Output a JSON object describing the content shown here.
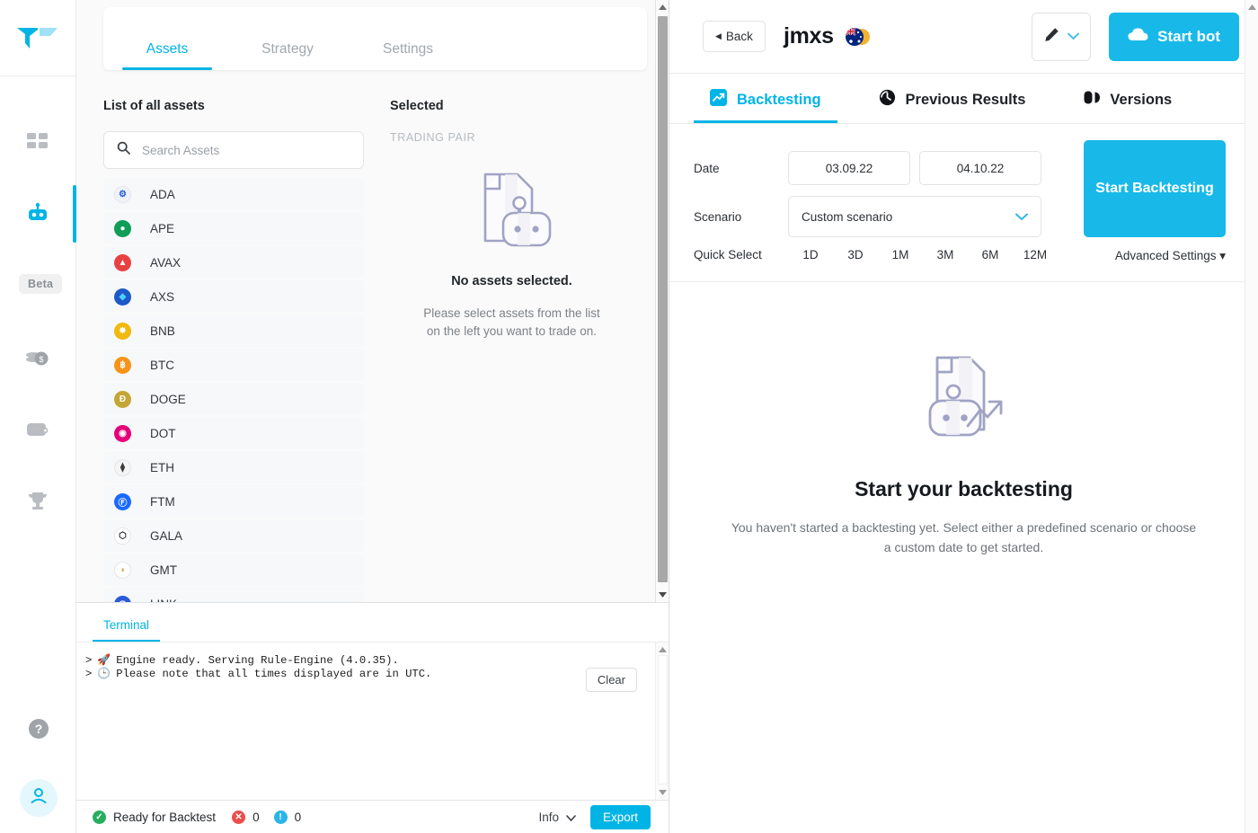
{
  "rail": {
    "logo": "trality-logo",
    "items": [
      {
        "name": "dashboard",
        "icon": "grid-icon"
      },
      {
        "name": "bots",
        "icon": "robot-icon",
        "active": true
      },
      {
        "name": "marketplace",
        "icon": "store-icon",
        "badge": "Beta"
      },
      {
        "name": "earnings",
        "icon": "coins-icon"
      },
      {
        "name": "wallet",
        "icon": "wallet-icon"
      },
      {
        "name": "leaderboard",
        "icon": "trophy-icon"
      }
    ],
    "help_icon": "help-circle-icon",
    "avatar_icon": "user-icon"
  },
  "editor": {
    "tabs": [
      {
        "label": "Assets",
        "active": true
      },
      {
        "label": "Strategy",
        "active": false
      },
      {
        "label": "Settings",
        "active": false
      }
    ],
    "assets_pane": {
      "title": "List of all assets",
      "search_placeholder": "Search Assets",
      "search_value": "",
      "search_icon": "search-icon",
      "assets": [
        {
          "symbol": "ADA",
          "color": "#eef3fb",
          "glyph": "⚙",
          "text_color": "#2a5ada"
        },
        {
          "symbol": "APE",
          "color": "#0f9d58",
          "glyph": "●",
          "text_color": "#ffffff"
        },
        {
          "symbol": "AVAX",
          "color": "#e84142",
          "glyph": "▲",
          "text_color": "#ffffff"
        },
        {
          "symbol": "AXS",
          "color": "#1e5ac7",
          "glyph": "◆",
          "text_color": "#4fd0ff"
        },
        {
          "symbol": "BNB",
          "color": "#f0b90b",
          "glyph": "✸",
          "text_color": "#ffffff"
        },
        {
          "symbol": "BTC",
          "color": "#f7931a",
          "glyph": "฿",
          "text_color": "#ffffff"
        },
        {
          "symbol": "DOGE",
          "color": "#c3a634",
          "glyph": "Đ",
          "text_color": "#ffffff"
        },
        {
          "symbol": "DOT",
          "color": "#e6007a",
          "glyph": "◉",
          "text_color": "#ffffff"
        },
        {
          "symbol": "ETH",
          "color": "#f4f4f5",
          "glyph": "⧫",
          "text_color": "#3c3c3d"
        },
        {
          "symbol": "FTM",
          "color": "#1969ff",
          "glyph": "Ⓕ",
          "text_color": "#ffffff"
        },
        {
          "symbol": "GALA",
          "color": "#ffffff",
          "glyph": "⬡",
          "text_color": "#1a1a1a"
        },
        {
          "symbol": "GMT",
          "color": "#ffffff",
          "glyph": "◖",
          "text_color": "#d8a13a"
        },
        {
          "symbol": "LINK",
          "color": "#2a5ada",
          "glyph": "◉",
          "text_color": "#ffffff"
        }
      ]
    },
    "selected_pane": {
      "title": "Selected",
      "column_header": "TRADING PAIR",
      "empty_illustration": "document-robot-icon",
      "empty_title": "No assets selected.",
      "empty_text": "Please select assets from the list on the left you want to trade on."
    }
  },
  "terminal": {
    "tab_label": "Terminal",
    "clear_label": "Clear",
    "lines": [
      {
        "prompt": ">",
        "emoji": "🚀",
        "text": "Engine ready. Serving Rule-Engine (4.0.35)."
      },
      {
        "prompt": ">",
        "emoji": "🕒",
        "text": "Please note that all times displayed are in UTC."
      }
    ]
  },
  "statusbar": {
    "status_icon": "check-circle-icon",
    "status_text": "Ready for Backtest",
    "error_icon": "error-circle-icon",
    "error_count": "0",
    "info_icon": "info-circle-icon",
    "info_count": "0",
    "info_select_label": "Info",
    "export_label": "Export"
  },
  "bot": {
    "back_label": "Back",
    "title": "jmxs",
    "flag_icon": "australia-flag-icon",
    "edit_icon": "pencil-icon",
    "edit_caret_icon": "chevron-down-icon",
    "start_bot_label": "Start bot",
    "start_bot_icon": "cloud-upload-icon",
    "tabs": [
      {
        "label": "Backtesting",
        "icon": "backtest-chart-icon",
        "active": true
      },
      {
        "label": "Previous Results",
        "icon": "history-clock-icon",
        "active": false
      },
      {
        "label": "Versions",
        "icon": "versions-icon",
        "active": false
      }
    ]
  },
  "backtest_form": {
    "date_label": "Date",
    "date_from": "03.09.22",
    "date_to": "04.10.22",
    "scenario_label": "Scenario",
    "scenario_value": "Custom scenario",
    "scenario_caret_icon": "chevron-down-icon",
    "quick_select_label": "Quick Select",
    "quick_options": [
      "1D",
      "3D",
      "1M",
      "3M",
      "6M",
      "12M"
    ],
    "start_backtesting_label": "Start Backtesting",
    "advanced_settings_label": "Advanced Settings"
  },
  "backtest_empty": {
    "illustration": "document-robot-chart-icon",
    "title": "Start your backtesting",
    "text_line1": "You haven't started a backtesting yet. Select either a predefined scenario or choose",
    "text_line2": "a custom date to get started."
  },
  "colors": {
    "accent": "#00b4e6",
    "accent_button": "#18b9e8",
    "illustration": "#a0a3c4",
    "row_bg": "#f7f8f9"
  }
}
